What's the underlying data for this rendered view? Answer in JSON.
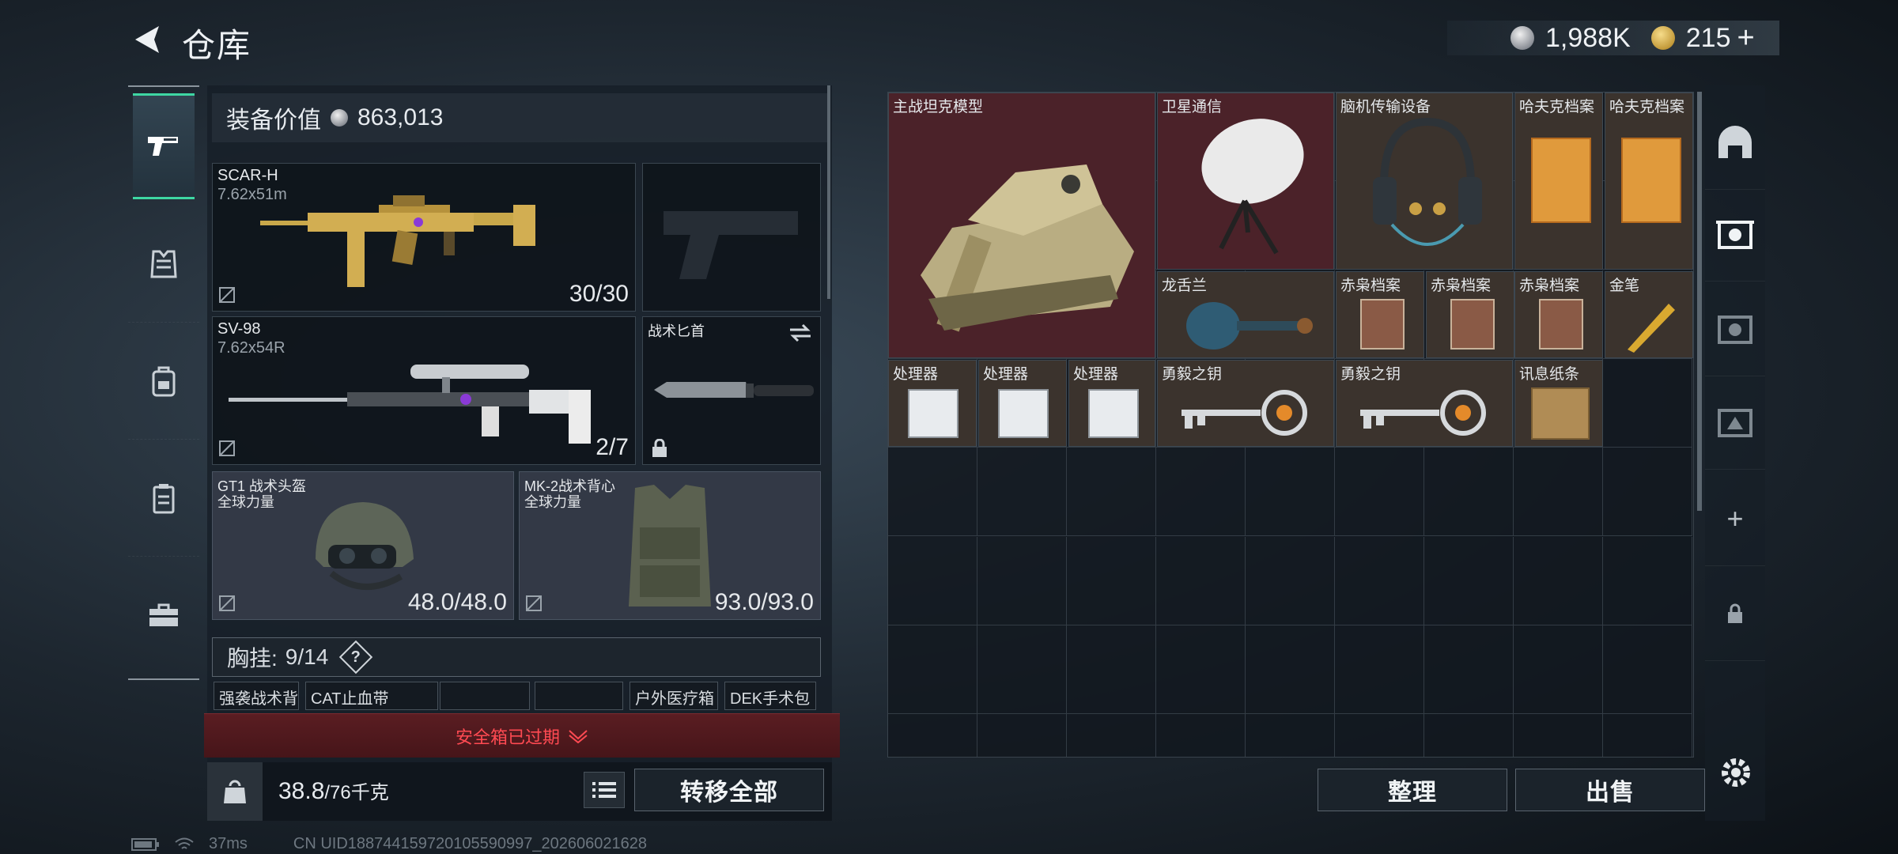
{
  "header": {
    "title": "仓库",
    "silver": "1,988K",
    "gold": "215",
    "gold_plus": "+"
  },
  "left": {
    "tabs": [
      "weapon-tab",
      "armor-tab",
      "backpack-tab",
      "case-tab",
      "toolbox-tab"
    ],
    "equip_value_label": "装备价值",
    "equip_value": "863,013",
    "primary": {
      "name": "SCAR-H",
      "ammo": "7.62x51m",
      "count": "30/30"
    },
    "secondary": {
      "name": "SV-98",
      "ammo": "7.62x54R",
      "count": "2/7"
    },
    "melee": {
      "name": "战术匕首"
    },
    "helmet": {
      "name": "GT1 战术头盔",
      "brand": "全球力量",
      "durability": "48.0/48.0"
    },
    "vest": {
      "name": "MK-2战术背心",
      "brand": "全球力量",
      "durability": "93.0/93.0"
    },
    "chest_label": "胸挂:",
    "chest_count": "9/14",
    "chest_help": "?",
    "pouches": [
      "强袭战术背心",
      "CAT止血带",
      "",
      "",
      "户外医疗箱",
      "DEK手术包"
    ],
    "safe_box_expired": "安全箱已过期",
    "weight_value": "38.8",
    "weight_max": "/76千克",
    "transfer_all": "转移全部"
  },
  "storage": {
    "items": [
      {
        "name": "主战坦克模型",
        "kind": "tank"
      },
      {
        "name": "卫星通信",
        "kind": "dish"
      },
      {
        "name": "脑机传输设备",
        "kind": "headset"
      },
      {
        "name": "哈夫克档案",
        "kind": "file"
      },
      {
        "name": "哈夫克档案",
        "kind": "file"
      },
      {
        "name": "龙舌兰",
        "kind": "bottle"
      },
      {
        "name": "赤枭档案",
        "kind": "owl"
      },
      {
        "name": "赤枭档案",
        "kind": "owl"
      },
      {
        "name": "赤枭档案",
        "kind": "owl"
      },
      {
        "name": "金笔",
        "kind": "pen"
      },
      {
        "name": "处理器",
        "kind": "cpu"
      },
      {
        "name": "处理器",
        "kind": "cpu"
      },
      {
        "name": "处理器",
        "kind": "cpu"
      },
      {
        "name": "勇毅之钥",
        "kind": "key"
      },
      {
        "name": "勇毅之钥",
        "kind": "key"
      },
      {
        "name": "讯息纸条",
        "kind": "note"
      }
    ],
    "sort_label": "整理",
    "sell_label": "出售",
    "add_tab": "+"
  },
  "status": {
    "ping": "37ms",
    "uid": "CN UID18874415972010559099​7_202606021628"
  },
  "colors": {
    "accent": "#3ed7a3",
    "expired": "#ff4a52",
    "rare_red": "#4b2229",
    "rare_brown": "#3b332d"
  }
}
